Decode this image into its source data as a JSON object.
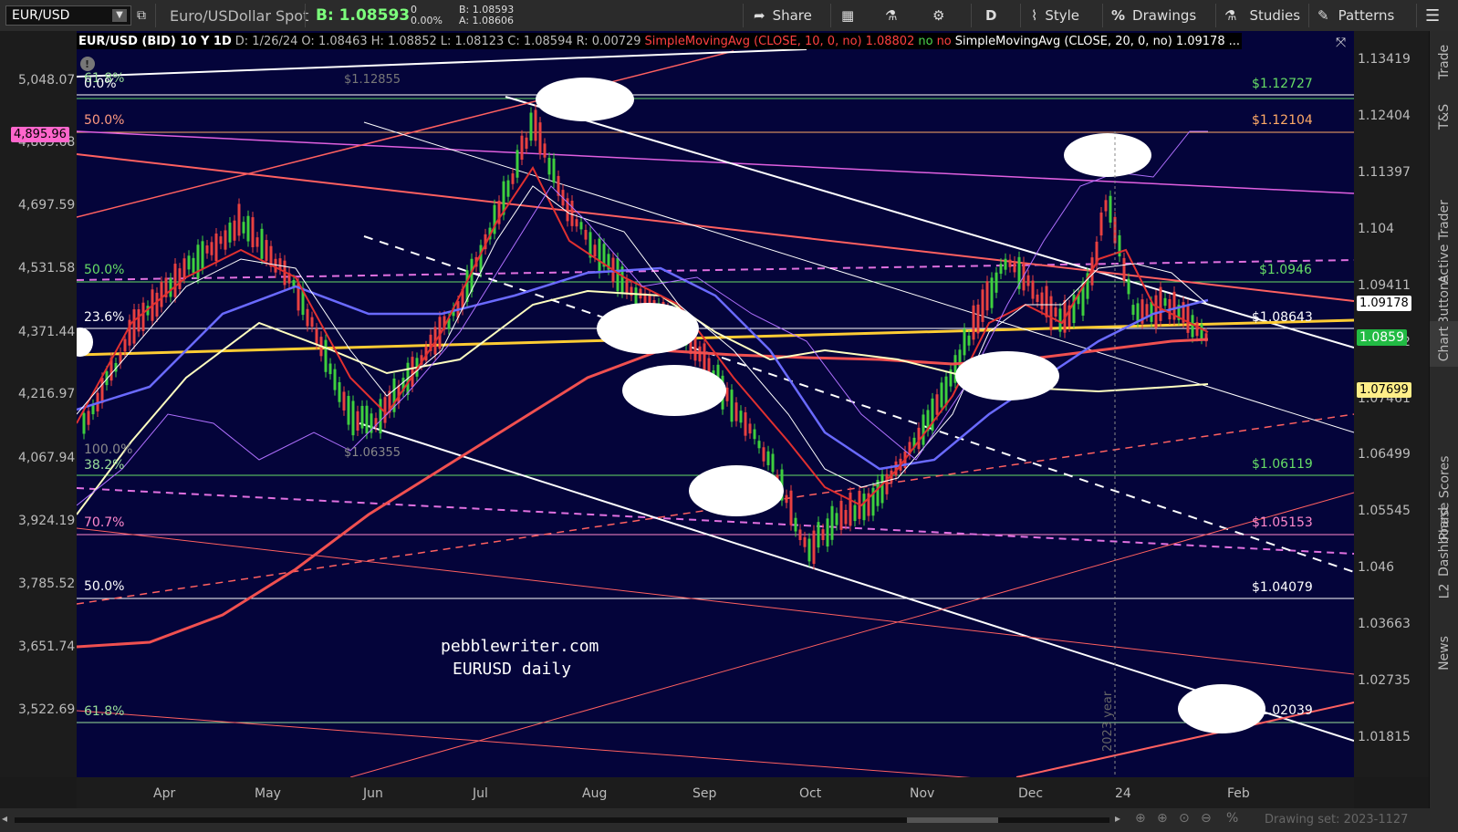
{
  "toolbar": {
    "symbol": "EUR/USD",
    "description": "Euro/USDollar Spot",
    "bid_label": "B: 1.08593",
    "change": "0",
    "change_pct": "0.00%",
    "bid_small": "B: 1.08593",
    "ask_small": "A: 1.08606",
    "share": "Share",
    "aggregation": "D",
    "style": "Style",
    "drawings": "Drawings",
    "studies": "Studies",
    "patterns": "Patterns"
  },
  "infobar": {
    "title": "EUR/USD (BID) 10 Y 1D",
    "date": "D: 1/26/24",
    "open": "O: 1.08463",
    "high": "H: 1.08852",
    "low": "L: 1.08123",
    "close": "C: 1.08594",
    "range": "R: 0.00729",
    "sma10": "SimpleMovingAvg (CLOSE, 10, 0, no)",
    "sma10_val": "1.08802",
    "no1": "no",
    "no2": "no",
    "sma20": "SimpleMovingAvg (CLOSE, 20, 0, no)",
    "sma20_val": "1.09178",
    "more": "..."
  },
  "left_axis": [
    "5,048.07",
    "4,869.68",
    "4,697.59",
    "4,531.58",
    "4,371.44",
    "4,216.97",
    "4,067.94",
    "3,924.19",
    "3,785.52",
    "3,651.74",
    "3,522.69"
  ],
  "left_tag": "4,895.96",
  "right_axis": [
    "1.13419",
    "1.12404",
    "1.11397",
    "1.104",
    "1.09411",
    "1.08432",
    "1.07461",
    "1.06499",
    "1.05545",
    "1.046",
    "1.03663",
    "1.02735",
    "1.01815"
  ],
  "price_tags": {
    "sma20": "1.09178",
    "last": "1.0859",
    "yellow": "1.07699"
  },
  "x_axis": [
    "Apr",
    "May",
    "Jun",
    "Jul",
    "Aug",
    "Sep",
    "Oct",
    "Nov",
    "Dec",
    "24",
    "Feb"
  ],
  "fib_left": [
    {
      "label": "61.8%",
      "color": "#9adf9a"
    },
    {
      "label": "0.0%",
      "color": "#ffffff"
    },
    {
      "label": "50.0%",
      "color": "#ff9a80"
    },
    {
      "label": "50.0%",
      "color": "#66dd66"
    },
    {
      "label": "23.6%",
      "color": "#ffffff"
    },
    {
      "label": "100.0%",
      "color": "#888888"
    },
    {
      "label": "38.2%",
      "color": "#9adf9a"
    },
    {
      "label": "70.7%",
      "color": "#ff88cc"
    },
    {
      "label": "50.0%",
      "color": "#ffffff"
    },
    {
      "label": "61.8%",
      "color": "#9adf9a"
    }
  ],
  "fib_right": [
    {
      "label": "$1.12727",
      "color": "#66dd66"
    },
    {
      "label": "$1.12104",
      "color": "#ffaa66"
    },
    {
      "label": "$1.0946",
      "color": "#66dd66"
    },
    {
      "label": "$1.08643",
      "color": "#ffffff"
    },
    {
      "label": "$1.06119",
      "color": "#66dd66"
    },
    {
      "label": "$1.05153",
      "color": "#ff88cc"
    },
    {
      "label": "$1.04079",
      "color": "#ffffff"
    },
    {
      "label": "$1.02039",
      "color": "#ffffff"
    }
  ],
  "chart_labels": {
    "high_label": "$1.12855",
    "low_label": "$1.06355",
    "watermark1": "pebblewriter.com",
    "watermark2": "EURUSD daily",
    "year": "2023 year"
  },
  "side_tabs": [
    "Trade",
    "T&S",
    "Active Trader",
    "Buttons",
    "Chart",
    "Phase Scores",
    "Dashboard",
    "L2",
    "News"
  ],
  "bottom": {
    "drawing_set": "Drawing set: 2023-1127"
  },
  "colors": {
    "chart_bg": "#04043a",
    "sma_red": "#e83030",
    "sma_blue": "#6a6aff",
    "sma_yellow": "#ffffc0"
  }
}
